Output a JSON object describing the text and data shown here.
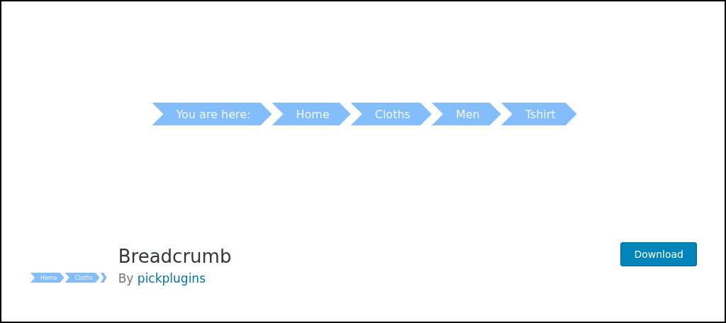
{
  "banner": {
    "breadcrumb": [
      {
        "label": "You are here:"
      },
      {
        "label": "Home"
      },
      {
        "label": "Cloths"
      },
      {
        "label": "Men"
      },
      {
        "label": "Tshirt"
      }
    ]
  },
  "plugin": {
    "icon_breadcrumb": [
      "Home",
      "Cloths"
    ],
    "title": "Breadcrumb",
    "byline": "By",
    "author": "pickplugins",
    "button": "Download"
  }
}
